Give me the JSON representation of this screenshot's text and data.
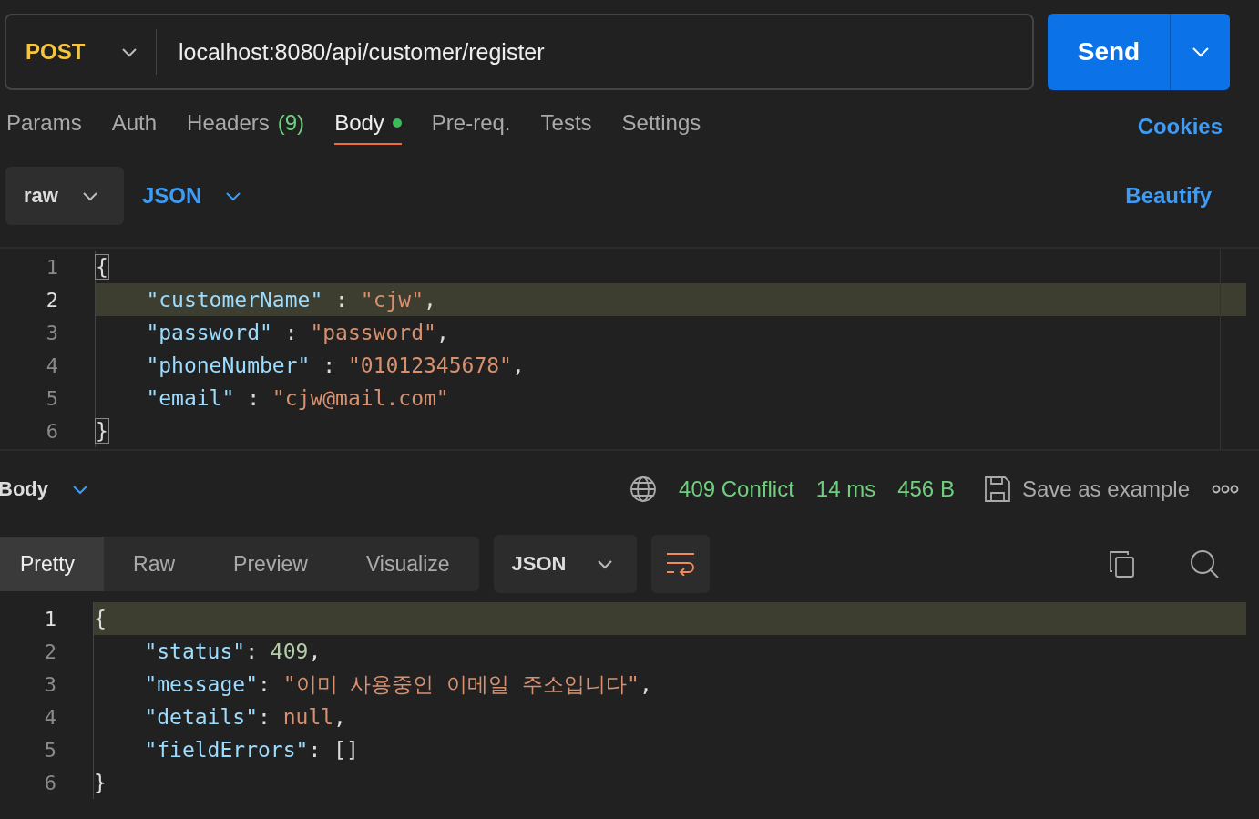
{
  "request": {
    "method": "POST",
    "url": "localhost:8080/api/customer/register",
    "send_label": "Send"
  },
  "tabs": [
    {
      "label": "Params",
      "selected": false
    },
    {
      "label": "Auth",
      "selected": false
    },
    {
      "label": "Headers",
      "count": "(9)",
      "selected": false
    },
    {
      "label": "Body",
      "selected": true,
      "has_content": true
    },
    {
      "label": "Pre-req.",
      "selected": false
    },
    {
      "label": "Tests",
      "selected": false
    },
    {
      "label": "Settings",
      "selected": false
    }
  ],
  "cookies_link": "Cookies",
  "body_options": {
    "mode": "raw",
    "language": "JSON",
    "beautify": "Beautify"
  },
  "request_body": [
    {
      "number": "1",
      "kind": "brace",
      "active": false,
      "tokens": [
        {
          "kind": "bracket",
          "text": "{"
        }
      ]
    },
    {
      "number": "2",
      "kind": "member",
      "active": true,
      "tokens": [
        {
          "kind": "key",
          "text": "\"customerName\""
        },
        {
          "kind": "punct",
          "text": " : "
        },
        {
          "kind": "string",
          "text": "\"cjw\""
        },
        {
          "kind": "punct",
          "text": ","
        }
      ]
    },
    {
      "number": "3",
      "kind": "member",
      "active": false,
      "tokens": [
        {
          "kind": "key",
          "text": "\"password\""
        },
        {
          "kind": "punct",
          "text": " : "
        },
        {
          "kind": "string",
          "text": "\"password\""
        },
        {
          "kind": "punct",
          "text": ","
        }
      ]
    },
    {
      "number": "4",
      "kind": "member",
      "active": false,
      "tokens": [
        {
          "kind": "key",
          "text": "\"phoneNumber\""
        },
        {
          "kind": "punct",
          "text": " : "
        },
        {
          "kind": "string",
          "text": "\"01012345678\""
        },
        {
          "kind": "punct",
          "text": ","
        }
      ]
    },
    {
      "number": "5",
      "kind": "member",
      "active": false,
      "tokens": [
        {
          "kind": "key",
          "text": "\"email\""
        },
        {
          "kind": "punct",
          "text": " : "
        },
        {
          "kind": "string",
          "text": "\"cjw@mail.com\""
        }
      ]
    },
    {
      "number": "6",
      "kind": "brace",
      "active": false,
      "tokens": [
        {
          "kind": "bracket",
          "text": "}"
        }
      ]
    }
  ],
  "response": {
    "label": "Body",
    "status": "409 Conflict",
    "time": "14 ms",
    "size": "456 B",
    "save_label": "Save as example",
    "view_tabs": [
      {
        "label": "Pretty",
        "selected": true
      },
      {
        "label": "Raw",
        "selected": false
      },
      {
        "label": "Preview",
        "selected": false
      },
      {
        "label": "Visualize",
        "selected": false
      }
    ],
    "format": "JSON",
    "wrap_on": true,
    "lines": [
      {
        "number": "1",
        "kind": "brace",
        "active": true,
        "tokens": [
          {
            "kind": "punct",
            "text": "{"
          }
        ]
      },
      {
        "number": "2",
        "kind": "member",
        "active": false,
        "tokens": [
          {
            "kind": "key",
            "text": "\"status\""
          },
          {
            "kind": "punct",
            "text": ": "
          },
          {
            "kind": "number",
            "text": "409"
          },
          {
            "kind": "punct",
            "text": ","
          }
        ]
      },
      {
        "number": "3",
        "kind": "member",
        "active": false,
        "tokens": [
          {
            "kind": "key",
            "text": "\"message\""
          },
          {
            "kind": "punct",
            "text": ": "
          },
          {
            "kind": "string",
            "text": "\"이미 사용중인 이메일 주소입니다\""
          },
          {
            "kind": "punct",
            "text": ","
          }
        ]
      },
      {
        "number": "4",
        "kind": "member",
        "active": false,
        "tokens": [
          {
            "kind": "key",
            "text": "\"details\""
          },
          {
            "kind": "punct",
            "text": ": "
          },
          {
            "kind": "string",
            "text": "null"
          },
          {
            "kind": "punct",
            "text": ","
          }
        ]
      },
      {
        "number": "5",
        "kind": "member",
        "active": false,
        "tokens": [
          {
            "kind": "key",
            "text": "\"fieldErrors\""
          },
          {
            "kind": "punct",
            "text": ": "
          },
          {
            "kind": "punct",
            "text": "[]"
          }
        ]
      },
      {
        "number": "6",
        "kind": "brace",
        "active": false,
        "tokens": [
          {
            "kind": "punct",
            "text": "}"
          }
        ]
      }
    ]
  }
}
